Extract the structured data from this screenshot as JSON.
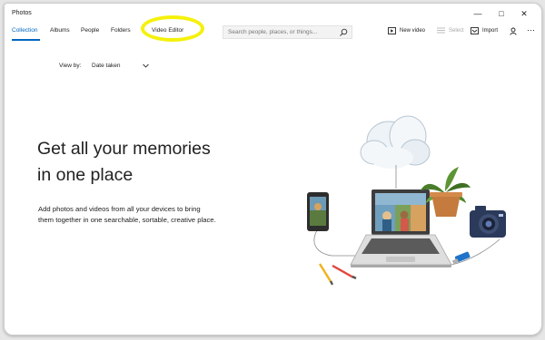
{
  "window": {
    "title": "Photos"
  },
  "window_controls": {
    "minimize": "—",
    "maximize": "□",
    "close": "✕"
  },
  "nav": {
    "items": [
      {
        "label": "Collection",
        "active": true
      },
      {
        "label": "Albums"
      },
      {
        "label": "People"
      },
      {
        "label": "Folders"
      },
      {
        "label": "Video Editor"
      }
    ]
  },
  "highlight": {
    "color": "#f5f10a"
  },
  "search": {
    "placeholder": "Search people, places, or things..."
  },
  "toolbar": {
    "new_video": "New video",
    "select": "Select",
    "import": "Import",
    "more": "⋯"
  },
  "view": {
    "label": "View by:",
    "value": "Date taken"
  },
  "hero": {
    "line1": "Get all your memories",
    "line2": "in one place",
    "description_line1": "Add photos and videos from all your devices to bring",
    "description_line2": "them together in one searchable, sortable, creative place."
  },
  "colors": {
    "accent": "#0067c0",
    "text": "#222222",
    "background": "#ffffff"
  },
  "icons": [
    "search-icon",
    "video-icon",
    "select-icon",
    "import-icon",
    "account-icon",
    "more-icon",
    "chevron-down-icon"
  ]
}
